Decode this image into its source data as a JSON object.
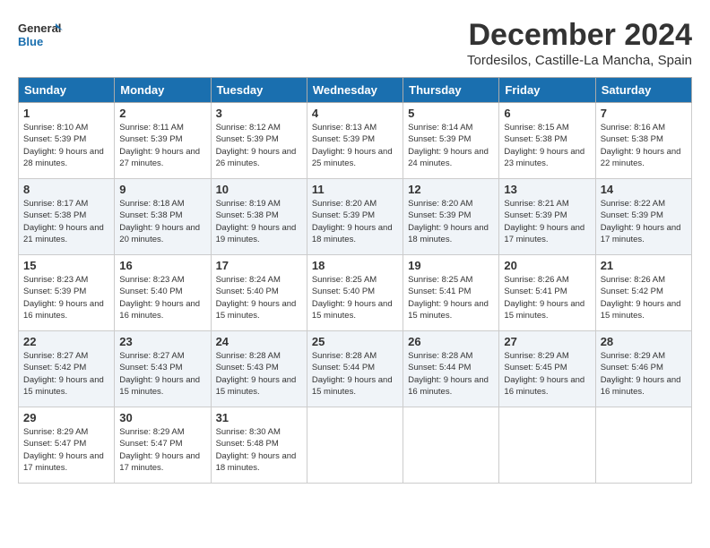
{
  "header": {
    "logo_line1": "General",
    "logo_line2": "Blue",
    "month": "December 2024",
    "location": "Tordesilos, Castille-La Mancha, Spain"
  },
  "weekdays": [
    "Sunday",
    "Monday",
    "Tuesday",
    "Wednesday",
    "Thursday",
    "Friday",
    "Saturday"
  ],
  "weeks": [
    [
      {
        "day": "1",
        "sunrise": "Sunrise: 8:10 AM",
        "sunset": "Sunset: 5:39 PM",
        "daylight": "Daylight: 9 hours and 28 minutes."
      },
      {
        "day": "2",
        "sunrise": "Sunrise: 8:11 AM",
        "sunset": "Sunset: 5:39 PM",
        "daylight": "Daylight: 9 hours and 27 minutes."
      },
      {
        "day": "3",
        "sunrise": "Sunrise: 8:12 AM",
        "sunset": "Sunset: 5:39 PM",
        "daylight": "Daylight: 9 hours and 26 minutes."
      },
      {
        "day": "4",
        "sunrise": "Sunrise: 8:13 AM",
        "sunset": "Sunset: 5:39 PM",
        "daylight": "Daylight: 9 hours and 25 minutes."
      },
      {
        "day": "5",
        "sunrise": "Sunrise: 8:14 AM",
        "sunset": "Sunset: 5:39 PM",
        "daylight": "Daylight: 9 hours and 24 minutes."
      },
      {
        "day": "6",
        "sunrise": "Sunrise: 8:15 AM",
        "sunset": "Sunset: 5:38 PM",
        "daylight": "Daylight: 9 hours and 23 minutes."
      },
      {
        "day": "7",
        "sunrise": "Sunrise: 8:16 AM",
        "sunset": "Sunset: 5:38 PM",
        "daylight": "Daylight: 9 hours and 22 minutes."
      }
    ],
    [
      {
        "day": "8",
        "sunrise": "Sunrise: 8:17 AM",
        "sunset": "Sunset: 5:38 PM",
        "daylight": "Daylight: 9 hours and 21 minutes."
      },
      {
        "day": "9",
        "sunrise": "Sunrise: 8:18 AM",
        "sunset": "Sunset: 5:38 PM",
        "daylight": "Daylight: 9 hours and 20 minutes."
      },
      {
        "day": "10",
        "sunrise": "Sunrise: 8:19 AM",
        "sunset": "Sunset: 5:38 PM",
        "daylight": "Daylight: 9 hours and 19 minutes."
      },
      {
        "day": "11",
        "sunrise": "Sunrise: 8:20 AM",
        "sunset": "Sunset: 5:39 PM",
        "daylight": "Daylight: 9 hours and 18 minutes."
      },
      {
        "day": "12",
        "sunrise": "Sunrise: 8:20 AM",
        "sunset": "Sunset: 5:39 PM",
        "daylight": "Daylight: 9 hours and 18 minutes."
      },
      {
        "day": "13",
        "sunrise": "Sunrise: 8:21 AM",
        "sunset": "Sunset: 5:39 PM",
        "daylight": "Daylight: 9 hours and 17 minutes."
      },
      {
        "day": "14",
        "sunrise": "Sunrise: 8:22 AM",
        "sunset": "Sunset: 5:39 PM",
        "daylight": "Daylight: 9 hours and 17 minutes."
      }
    ],
    [
      {
        "day": "15",
        "sunrise": "Sunrise: 8:23 AM",
        "sunset": "Sunset: 5:39 PM",
        "daylight": "Daylight: 9 hours and 16 minutes."
      },
      {
        "day": "16",
        "sunrise": "Sunrise: 8:23 AM",
        "sunset": "Sunset: 5:40 PM",
        "daylight": "Daylight: 9 hours and 16 minutes."
      },
      {
        "day": "17",
        "sunrise": "Sunrise: 8:24 AM",
        "sunset": "Sunset: 5:40 PM",
        "daylight": "Daylight: 9 hours and 15 minutes."
      },
      {
        "day": "18",
        "sunrise": "Sunrise: 8:25 AM",
        "sunset": "Sunset: 5:40 PM",
        "daylight": "Daylight: 9 hours and 15 minutes."
      },
      {
        "day": "19",
        "sunrise": "Sunrise: 8:25 AM",
        "sunset": "Sunset: 5:41 PM",
        "daylight": "Daylight: 9 hours and 15 minutes."
      },
      {
        "day": "20",
        "sunrise": "Sunrise: 8:26 AM",
        "sunset": "Sunset: 5:41 PM",
        "daylight": "Daylight: 9 hours and 15 minutes."
      },
      {
        "day": "21",
        "sunrise": "Sunrise: 8:26 AM",
        "sunset": "Sunset: 5:42 PM",
        "daylight": "Daylight: 9 hours and 15 minutes."
      }
    ],
    [
      {
        "day": "22",
        "sunrise": "Sunrise: 8:27 AM",
        "sunset": "Sunset: 5:42 PM",
        "daylight": "Daylight: 9 hours and 15 minutes."
      },
      {
        "day": "23",
        "sunrise": "Sunrise: 8:27 AM",
        "sunset": "Sunset: 5:43 PM",
        "daylight": "Daylight: 9 hours and 15 minutes."
      },
      {
        "day": "24",
        "sunrise": "Sunrise: 8:28 AM",
        "sunset": "Sunset: 5:43 PM",
        "daylight": "Daylight: 9 hours and 15 minutes."
      },
      {
        "day": "25",
        "sunrise": "Sunrise: 8:28 AM",
        "sunset": "Sunset: 5:44 PM",
        "daylight": "Daylight: 9 hours and 15 minutes."
      },
      {
        "day": "26",
        "sunrise": "Sunrise: 8:28 AM",
        "sunset": "Sunset: 5:44 PM",
        "daylight": "Daylight: 9 hours and 16 minutes."
      },
      {
        "day": "27",
        "sunrise": "Sunrise: 8:29 AM",
        "sunset": "Sunset: 5:45 PM",
        "daylight": "Daylight: 9 hours and 16 minutes."
      },
      {
        "day": "28",
        "sunrise": "Sunrise: 8:29 AM",
        "sunset": "Sunset: 5:46 PM",
        "daylight": "Daylight: 9 hours and 16 minutes."
      }
    ],
    [
      {
        "day": "29",
        "sunrise": "Sunrise: 8:29 AM",
        "sunset": "Sunset: 5:47 PM",
        "daylight": "Daylight: 9 hours and 17 minutes."
      },
      {
        "day": "30",
        "sunrise": "Sunrise: 8:29 AM",
        "sunset": "Sunset: 5:47 PM",
        "daylight": "Daylight: 9 hours and 17 minutes."
      },
      {
        "day": "31",
        "sunrise": "Sunrise: 8:30 AM",
        "sunset": "Sunset: 5:48 PM",
        "daylight": "Daylight: 9 hours and 18 minutes."
      },
      null,
      null,
      null,
      null
    ]
  ]
}
